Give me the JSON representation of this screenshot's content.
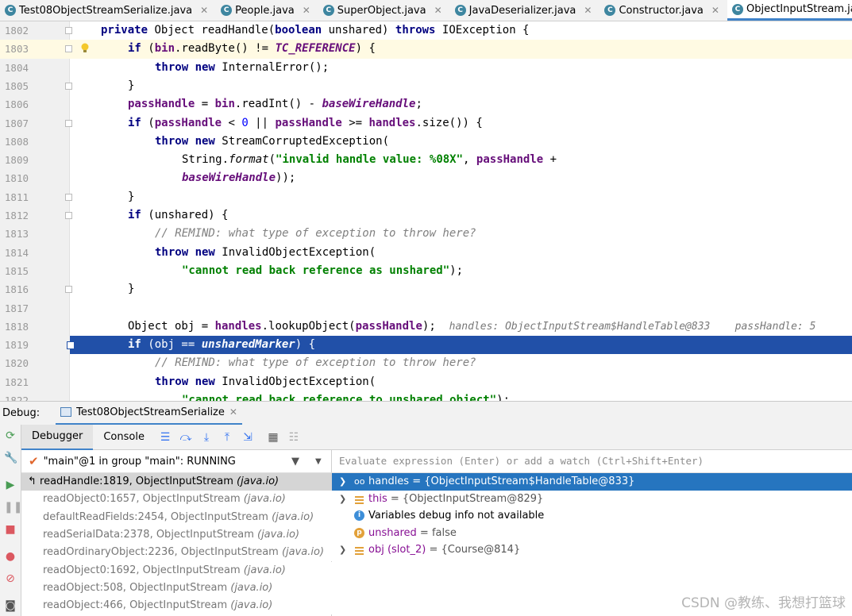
{
  "tabs": [
    {
      "label": "Test08ObjectStreamSerialize.java",
      "active": false,
      "icon": "run-class-icon"
    },
    {
      "label": "People.java",
      "active": false,
      "icon": "class-icon"
    },
    {
      "label": "SuperObject.java",
      "active": false,
      "icon": "class-icon"
    },
    {
      "label": "JavaDeserializer.java",
      "active": false,
      "icon": "class-icon"
    },
    {
      "label": "Constructor.java",
      "active": false,
      "icon": "class-icon"
    },
    {
      "label": "ObjectInputStream.java",
      "active": true,
      "icon": "class-icon"
    }
  ],
  "editor": {
    "lines": [
      {
        "n": "1802",
        "html": "<span class=\"kw\">private</span> Object readHandle(<span class=\"kw\">boolean</span> unshared) <span class=\"kw\">throws</span> IOException {",
        "indent": 0
      },
      {
        "n": "1803",
        "html": "<span class=\"kw\">if</span> (<span class=\"fld\">bin</span>.readByte() != <span class=\"it\">TC_REFERENCE</span>) {",
        "indent": 1
      },
      {
        "n": "1804",
        "html": "<span class=\"kw\">throw new</span> InternalError();",
        "indent": 2
      },
      {
        "n": "1805",
        "html": "}",
        "indent": 1
      },
      {
        "n": "1806",
        "html": "<span class=\"fld\">passHandle</span> = <span class=\"fld\">bin</span>.readInt() - <span class=\"it\">baseWireHandle</span>;",
        "indent": 1
      },
      {
        "n": "1807",
        "html": "<span class=\"kw\">if</span> (<span class=\"fld\">passHandle</span> &lt; <span class=\"num\">0</span> || <span class=\"fld\">passHandle</span> &gt;= <span class=\"fld\">handles</span>.size()) {",
        "indent": 1
      },
      {
        "n": "1808",
        "html": "<span class=\"kw\">throw new</span> StreamCorruptedException(",
        "indent": 2
      },
      {
        "n": "1809",
        "html": "String.<i>format</i>(<span class=\"st\">\"invalid handle value: %08X\"</span>, <span class=\"fld\">passHandle</span> +",
        "indent": 3
      },
      {
        "n": "1810",
        "html": "<span class=\"it\">baseWireHandle</span>));",
        "indent": 3
      },
      {
        "n": "1811",
        "html": "}",
        "indent": 1
      },
      {
        "n": "1812",
        "html": "<span class=\"kw\">if</span> (unshared) {",
        "indent": 1
      },
      {
        "n": "1813",
        "html": "<span class=\"cm\">// REMIND: what type of exception to throw here?</span>",
        "indent": 2
      },
      {
        "n": "1814",
        "html": "<span class=\"kw\">throw new</span> InvalidObjectException(",
        "indent": 2
      },
      {
        "n": "1815",
        "html": "<span class=\"st\">\"cannot read back reference as unshared\"</span>);",
        "indent": 3
      },
      {
        "n": "1816",
        "html": "}",
        "indent": 1
      },
      {
        "n": "1817",
        "html": "",
        "indent": 0
      },
      {
        "n": "1818",
        "html": "Object obj = <span class=\"fld\">handles</span>.lookupObject(<span class=\"fld\">passHandle</span>);  <span class=\"inl\">handles: ObjectInputStream$HandleTable@833    passHandle: 5</span>",
        "indent": 1
      },
      {
        "n": "1819",
        "html": "<span class=\"kw\">if</span> (obj == <span class=\"it\">unsharedMarker</span>) {",
        "indent": 1
      },
      {
        "n": "1820",
        "html": "<span class=\"cm\">// REMIND: what type of exception to throw here?</span>",
        "indent": 2
      },
      {
        "n": "1821",
        "html": "<span class=\"kw\">throw new</span> InvalidObjectException(",
        "indent": 2
      },
      {
        "n": "1822",
        "html": "<span class=\"st\">\"cannot read back reference to unshared object\"</span>);",
        "indent": 3
      }
    ]
  },
  "debug": {
    "label": "Debug:",
    "session": "Test08ObjectStreamSerialize",
    "tab_debugger": "Debugger",
    "tab_console": "Console",
    "thread": "\"main\"@1 in group \"main\": RUNNING",
    "eval_placeholder": "Evaluate expression (Enter) or add a watch (Ctrl+Shift+Enter)"
  },
  "frames": [
    {
      "method": "readHandle:1819, ObjectInputStream",
      "pkg": "(java.io)"
    },
    {
      "method": "readObject0:1657, ObjectInputStream",
      "pkg": "(java.io)"
    },
    {
      "method": "defaultReadFields:2454, ObjectInputStream",
      "pkg": "(java.io)"
    },
    {
      "method": "readSerialData:2378, ObjectInputStream",
      "pkg": "(java.io)"
    },
    {
      "method": "readOrdinaryObject:2236, ObjectInputStream",
      "pkg": "(java.io)"
    },
    {
      "method": "readObject0:1692, ObjectInputStream",
      "pkg": "(java.io)"
    },
    {
      "method": "readObject:508, ObjectInputStream",
      "pkg": "(java.io)"
    },
    {
      "method": "readObject:466, ObjectInputStream",
      "pkg": "(java.io)"
    }
  ],
  "variables": [
    {
      "name": "handles",
      "value": "= {ObjectInputStream$HandleTable@833}",
      "expand": true,
      "icon": "watch-icon",
      "sel": true
    },
    {
      "name": "this",
      "value": "= {ObjectInputStream@829}",
      "expand": true,
      "icon": "field-icon",
      "sel": false
    },
    {
      "name": "",
      "value": "Variables debug info not available",
      "expand": false,
      "icon": "info-icon",
      "sel": false
    },
    {
      "name": "unshared",
      "value": "= false",
      "expand": false,
      "icon": "param-icon",
      "sel": false
    },
    {
      "name": "obj (slot_2)",
      "value": "= {Course@814}",
      "expand": true,
      "icon": "field-icon",
      "sel": false
    }
  ],
  "watermark": "CSDN @教练、我想打篮球"
}
